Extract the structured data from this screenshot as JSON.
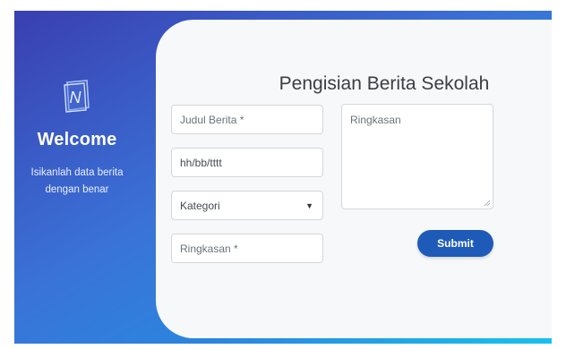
{
  "sidebar": {
    "logo_icon": "notebook-n-icon",
    "welcome": "Welcome",
    "subtitle": "Isikanlah data berita dengan benar"
  },
  "form": {
    "title": "Pengisian Berita Sekolah",
    "judul_placeholder": "Judul Berita *",
    "tanggal_placeholder": "hh/bb/tttt",
    "kategori_selected": "Kategori",
    "ringkasan_placeholder": "Ringkasan *",
    "textarea_placeholder": "Ringkasan",
    "submit_label": "Submit"
  },
  "colors": {
    "gradient_start": "#3a3fb0",
    "gradient_end": "#17c2ee",
    "button": "#1e5bb8",
    "card": "#f7f8f9"
  }
}
